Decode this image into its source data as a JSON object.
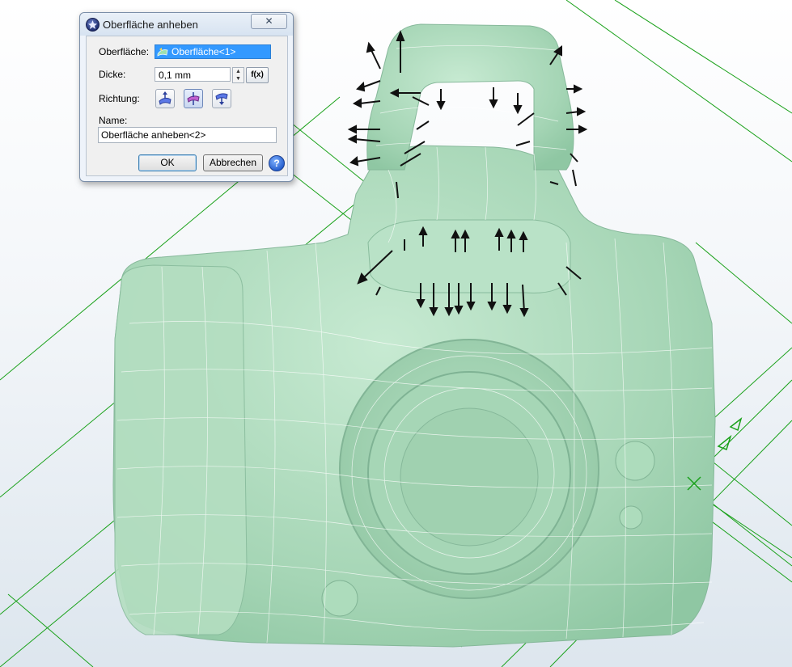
{
  "dialog": {
    "title": "Oberfläche anheben",
    "close_symbol": "✕",
    "surface_label": "Oberfläche:",
    "surface_value": "Oberfläche<1>",
    "thickness_label": "Dicke:",
    "thickness_value": "0,1 mm",
    "fx_label": "f(x)",
    "direction_label": "Richtung:",
    "direction_buttons": [
      {
        "icon": "direction-outward-icon"
      },
      {
        "icon": "direction-both-icon",
        "active": true
      },
      {
        "icon": "direction-inward-icon"
      }
    ],
    "name_label": "Name:",
    "name_value": "Oberfläche anheben<2>",
    "ok_label": "OK",
    "cancel_label": "Abbrechen",
    "help_symbol": "?"
  },
  "viewport": {
    "model_color": "#a9d8b8",
    "mesh_color": "#ffffff",
    "guide_line_color": "#1aa11a",
    "arrow_color": "#111111"
  }
}
